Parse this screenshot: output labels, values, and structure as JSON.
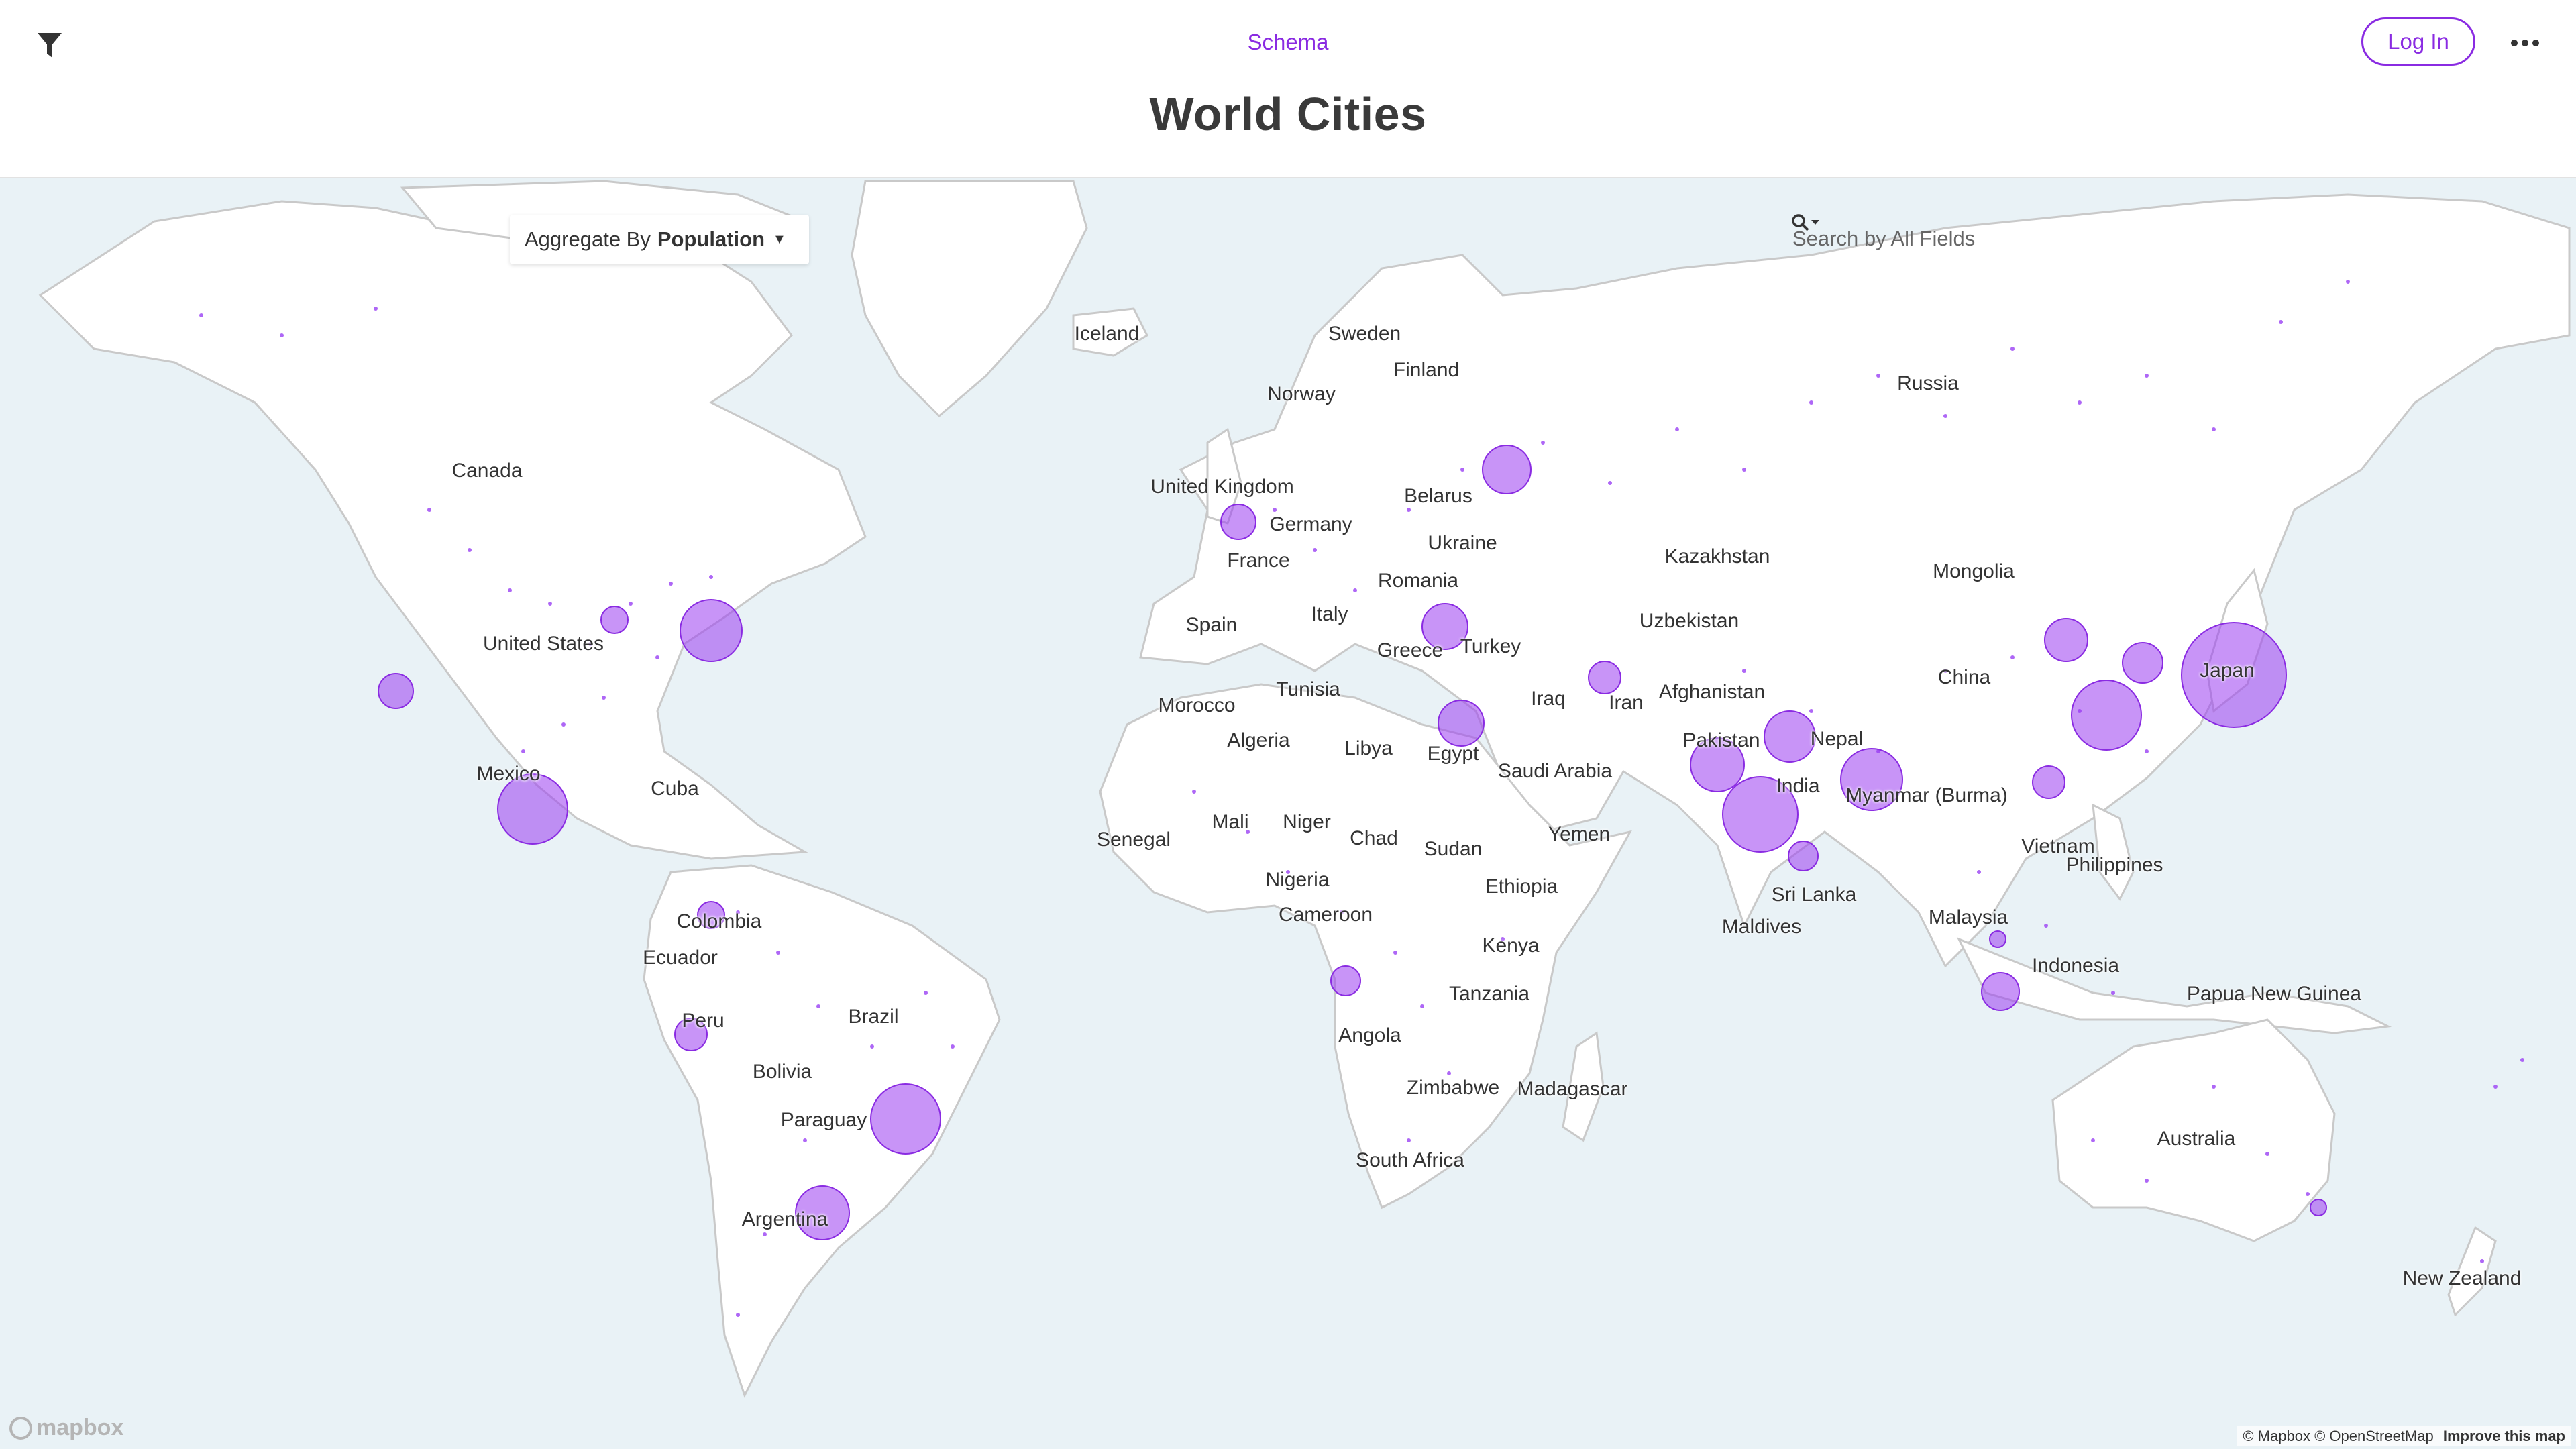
{
  "header": {
    "schema_label": "Schema",
    "title": "World Cities",
    "login_label": "Log In",
    "filter_icon": "filter-icon",
    "more_icon": "more-icon"
  },
  "controls": {
    "aggregate_prefix": "Aggregate By",
    "aggregate_value": "Population",
    "search_placeholder": "Search by All Fields"
  },
  "map": {
    "labels": [
      "Iceland",
      "Sweden",
      "Finland",
      "Norway",
      "Russia",
      "Canada",
      "United Kingdom",
      "Belarus",
      "Germany",
      "Ukraine",
      "France",
      "Kazakhstan",
      "Romania",
      "Mongolia",
      "Spain",
      "Italy",
      "Uzbekistan",
      "Greece",
      "Turkey",
      "United States",
      "China",
      "Tunisia",
      "Morocco",
      "Afghanistan",
      "Japan",
      "Iraq",
      "Iran",
      "Algeria",
      "Libya",
      "Egypt",
      "Nepal",
      "Pakistan",
      "Saudi Arabia",
      "Mexico",
      "Cuba",
      "India",
      "Myanmar (Burma)",
      "Mali",
      "Niger",
      "Senegal",
      "Chad",
      "Yemen",
      "Sudan",
      "Vietnam",
      "Philippines",
      "Nigeria",
      "Ethiopia",
      "Sri Lanka",
      "Colombia",
      "Cameroon",
      "Maldives",
      "Malaysia",
      "Ecuador",
      "Kenya",
      "Indonesia",
      "Brazil",
      "Tanzania",
      "Papua New Guinea",
      "Peru",
      "Angola",
      "Bolivia",
      "Zimbabwe",
      "Madagascar",
      "Paraguay",
      "Australia",
      "South Africa",
      "Argentina",
      "New Zealand"
    ],
    "attribution_mapbox": "© Mapbox",
    "attribution_osm": "© OpenStreetMap",
    "improve_label": "Improve this map",
    "logo_text": "mapbox"
  },
  "colors": {
    "accent": "#8a2be2",
    "water": "#e9f2f6",
    "land": "#ffffff",
    "dot": "#9b3cf0"
  }
}
